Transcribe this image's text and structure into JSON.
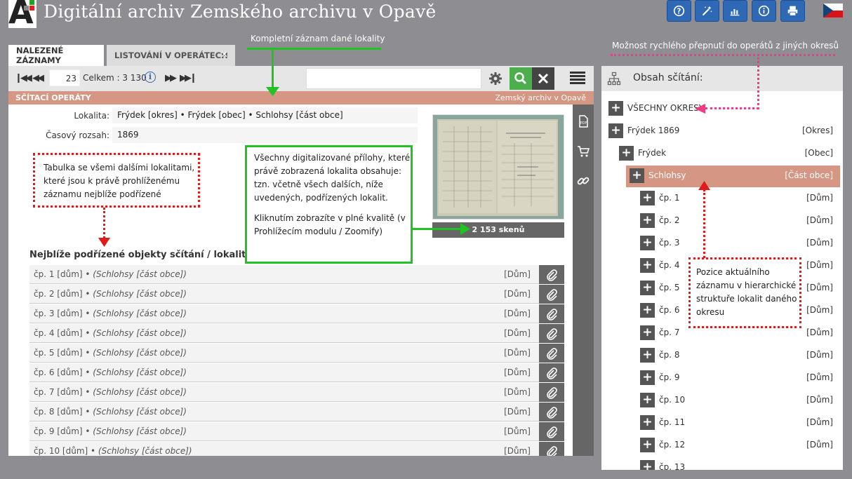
{
  "app": {
    "title": "Digitální archiv  Zemského archivu v Opavě",
    "logo_letter": "A"
  },
  "top_buttons": [
    "help-icon",
    "magic-wand-icon",
    "bar-chart-icon",
    "info-icon",
    "printer-icon"
  ],
  "tabs": [
    {
      "label": "NALEZENÉ ZÁZNAMY",
      "active": true
    },
    {
      "label": "LISTOVÁNÍ V OPERÁTECH",
      "active": false,
      "close": "✕"
    }
  ],
  "toolbar": {
    "page": "23",
    "total": "Celkem : 3 130",
    "info": "i"
  },
  "section": {
    "title": "SČÍTACÍ OPERÁTY",
    "archive": "Zemský archiv v Opavě"
  },
  "record": {
    "locality_label": "Lokalita:",
    "locality_value": "Frýdek [okres] • Frýdek [obec] • Schlohsy [část obce]",
    "range_label": "Časový rozsah:",
    "range_value": "1869",
    "scans": "2 153 skenů"
  },
  "children": {
    "heading": "Nejblíže podřízené objekty sčítání / lokality:",
    "rows": [
      {
        "name": "čp. 1 [dům]",
        "parent": "(Schlohsy [část obce])",
        "type": "[Dům]"
      },
      {
        "name": "čp. 2 [dům]",
        "parent": "(Schlohsy [část obce])",
        "type": "[Dům]"
      },
      {
        "name": "čp. 3 [dům]",
        "parent": "(Schlohsy [část obce])",
        "type": "[Dům]"
      },
      {
        "name": "čp. 4 [dům]",
        "parent": "(Schlohsy [část obce])",
        "type": "[Dům]"
      },
      {
        "name": "čp. 5 [dům]",
        "parent": "(Schlohsy [část obce])",
        "type": "[Dům]"
      },
      {
        "name": "čp. 6 [dům]",
        "parent": "(Schlohsy [část obce])",
        "type": "[Dům]"
      },
      {
        "name": "čp. 7 [dům]",
        "parent": "(Schlohsy [část obce])",
        "type": "[Dům]"
      },
      {
        "name": "čp. 8 [dům]",
        "parent": "(Schlohsy [část obce])",
        "type": "[Dům]"
      },
      {
        "name": "čp. 9 [dům]",
        "parent": "(Schlohsy [část obce])",
        "type": "[Dům]"
      },
      {
        "name": "čp. 10 [dům]",
        "parent": "(Schlohsy [část obce])",
        "type": "[Dům]"
      }
    ]
  },
  "side": {
    "title": "Obsah sčítání:",
    "tree": [
      {
        "label": "VŠECHNY OKRESY",
        "type": ""
      },
      {
        "label": "Frýdek 1869",
        "type": "[Okres]"
      },
      {
        "label": "Frýdek",
        "type": "[Obec]"
      },
      {
        "label": "Schlohsy",
        "type": "[Část obce]"
      },
      {
        "label": "čp. 1",
        "type": "[Dům]"
      },
      {
        "label": "čp. 2",
        "type": "[Dům]"
      },
      {
        "label": "čp. 3",
        "type": "[Dům]"
      },
      {
        "label": "čp. 4",
        "type": "[Dům]"
      },
      {
        "label": "čp. 5",
        "type": "[Dům]"
      },
      {
        "label": "čp. 6",
        "type": "[Dům]"
      },
      {
        "label": "čp. 7",
        "type": "[Dům]"
      },
      {
        "label": "čp. 8",
        "type": "[Dům]"
      },
      {
        "label": "čp. 9",
        "type": "[Dům]"
      },
      {
        "label": "čp. 10",
        "type": "[Dům]"
      },
      {
        "label": "čp. 11",
        "type": "[Dům]"
      },
      {
        "label": "čp. 12",
        "type": "[Dům]"
      },
      {
        "label": "čp. 13",
        "type": ""
      }
    ]
  },
  "annotations": {
    "complete_record": "Kompletní záznam dané lokality",
    "quick_switch": "Možnost rychlého přepnutí do operátů z jiných okresů",
    "table_note": "Tabulka se všemi dalšími lokalitami, které jsou k právě prohlíženému záznamu nejblíže podřízené",
    "scans_note_1": "Všechny digitalizované přílohy, které právě zobrazená lokalita obsahuje: tzn. včetně všech dalších, níže uvedených, podřízených lokalit.",
    "scans_note_2": "Kliknutím zobrazíte v plné kvalitě (v Prohlížecím modulu / Zoomify)",
    "position_note": "Pozice aktuálního záznamu v hierarchické struktuře lokalit daného okresu"
  }
}
